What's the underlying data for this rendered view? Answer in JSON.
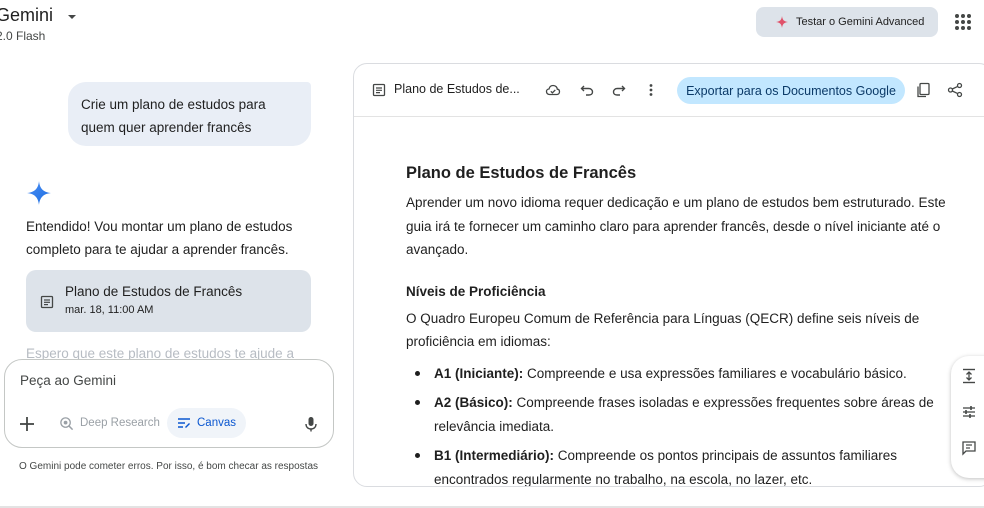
{
  "header": {
    "brand": "Gemini",
    "model": "2.0 Flash",
    "advanced_button": "Testar o Gemini Advanced"
  },
  "chat": {
    "user_message_line1": "Crie um plano de estudos para",
    "user_message_line2": "quem quer aprender francês",
    "reply_line1": "Entendido! Vou montar um plano de estudos",
    "reply_line2": "completo para te ajudar a aprender francês.",
    "doc_card_title": "Plano de Estudos de Francês",
    "doc_card_date": "mar. 18, 11:00 AM",
    "faded_text": "Espero que este plano de estudos te ajude a"
  },
  "prompt": {
    "placeholder": "Peça ao Gemini",
    "deep_research": "Deep Research",
    "canvas": "Canvas",
    "disclaimer": "O Gemini pode cometer erros. Por isso, é bom checar as respostas"
  },
  "panel": {
    "title": "Plano de Estudos de...",
    "export_button": "Exportar para os Documentos Google"
  },
  "document": {
    "h1": "Plano de Estudos de Francês",
    "intro": "Aprender um novo idioma requer dedicação e um plano de estudos bem estruturado. Este guia irá te fornecer um caminho claro para aprender francês, desde o nível iniciante até o avançado.",
    "h2": "Níveis de Proficiência",
    "p2": "O Quadro Europeu Comum de Referência para Línguas (QECR) define seis níveis de proficiência em idiomas:",
    "levels": [
      {
        "label": "A1 (Iniciante):",
        "text": " Compreende e usa expressões familiares e vocabulário básico."
      },
      {
        "label": "A2 (Básico):",
        "text": " Compreende frases isoladas e expressões frequentes sobre áreas de relevância imediata."
      },
      {
        "label": "B1 (Intermediário):",
        "text": " Compreende os pontos principais de assuntos familiares encontrados regularmente no trabalho, na escola, no lazer, etc."
      }
    ]
  },
  "colors": {
    "accent_blue": "#0b57d0",
    "export_bg": "#c2e7ff",
    "bubble_bg": "#e9eef6"
  }
}
